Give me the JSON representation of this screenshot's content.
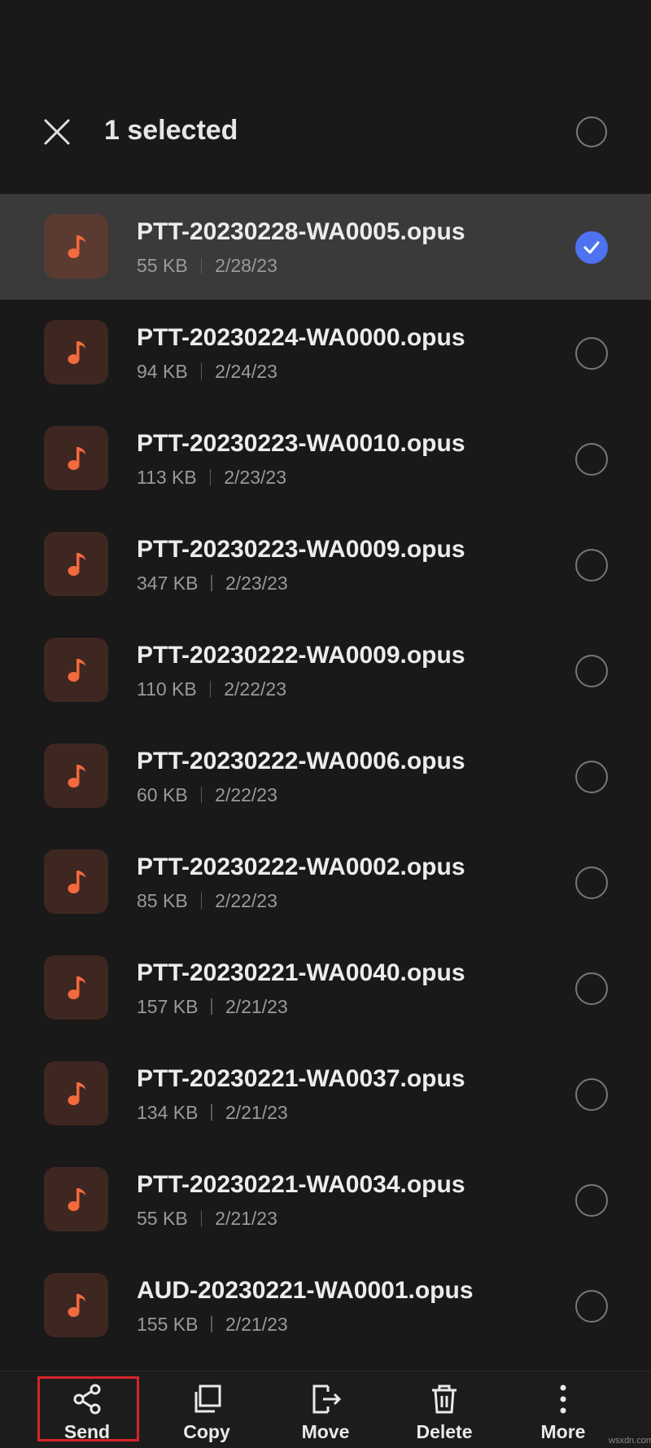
{
  "header": {
    "title": "1 selected",
    "close_icon": "close-icon",
    "select_all_state": "unchecked"
  },
  "files": [
    {
      "name": "PTT-20230228-WA0005.opus",
      "size": "55 KB",
      "date": "2/28/23",
      "selected": true
    },
    {
      "name": "PTT-20230224-WA0000.opus",
      "size": "94 KB",
      "date": "2/24/23",
      "selected": false
    },
    {
      "name": "PTT-20230223-WA0010.opus",
      "size": "113 KB",
      "date": "2/23/23",
      "selected": false
    },
    {
      "name": "PTT-20230223-WA0009.opus",
      "size": "347 KB",
      "date": "2/23/23",
      "selected": false
    },
    {
      "name": "PTT-20230222-WA0009.opus",
      "size": "110 KB",
      "date": "2/22/23",
      "selected": false
    },
    {
      "name": "PTT-20230222-WA0006.opus",
      "size": "60 KB",
      "date": "2/22/23",
      "selected": false
    },
    {
      "name": "PTT-20230222-WA0002.opus",
      "size": "85 KB",
      "date": "2/22/23",
      "selected": false
    },
    {
      "name": "PTT-20230221-WA0040.opus",
      "size": "157 KB",
      "date": "2/21/23",
      "selected": false
    },
    {
      "name": "PTT-20230221-WA0037.opus",
      "size": "134 KB",
      "date": "2/21/23",
      "selected": false
    },
    {
      "name": "PTT-20230221-WA0034.opus",
      "size": "55 KB",
      "date": "2/21/23",
      "selected": false
    },
    {
      "name": "AUD-20230221-WA0001.opus",
      "size": "155 KB",
      "date": "2/21/23",
      "selected": false
    }
  ],
  "actions": [
    {
      "label": "Send",
      "icon": "share-icon"
    },
    {
      "label": "Copy",
      "icon": "copy-icon"
    },
    {
      "label": "Move",
      "icon": "move-icon"
    },
    {
      "label": "Delete",
      "icon": "trash-icon"
    },
    {
      "label": "More",
      "icon": "more-vertical-icon"
    }
  ],
  "colors": {
    "background": "#191919",
    "selected_row": "#3a3a3a",
    "accent_check": "#4f72f0",
    "music_icon": "#f26a3d",
    "highlight_box": "#d8232a"
  },
  "watermark": "wsxdn.com"
}
